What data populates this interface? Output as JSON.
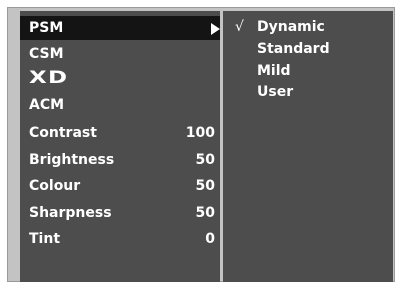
{
  "menu": {
    "items": [
      {
        "label": "PSM",
        "value": "",
        "selected": true,
        "has_submenu": true
      },
      {
        "label": "CSM",
        "value": ""
      },
      {
        "label": "XD",
        "value": "",
        "is_logo": true
      },
      {
        "label": "ACM",
        "value": ""
      },
      {
        "label": "Contrast",
        "value": "100"
      },
      {
        "label": "Brightness",
        "value": "50"
      },
      {
        "label": "Colour",
        "value": "50"
      },
      {
        "label": "Sharpness",
        "value": "50"
      },
      {
        "label": "Tint",
        "value": "0"
      }
    ]
  },
  "submenu": {
    "check_mark": "√",
    "selected_index": 0,
    "options": [
      {
        "label": "Dynamic"
      },
      {
        "label": "Standard"
      },
      {
        "label": "Mild"
      },
      {
        "label": "User"
      }
    ]
  },
  "colors": {
    "panel": "#4d4d4d",
    "highlight": "#141414",
    "frame": "#c3c3c3",
    "text": "#ffffff"
  }
}
